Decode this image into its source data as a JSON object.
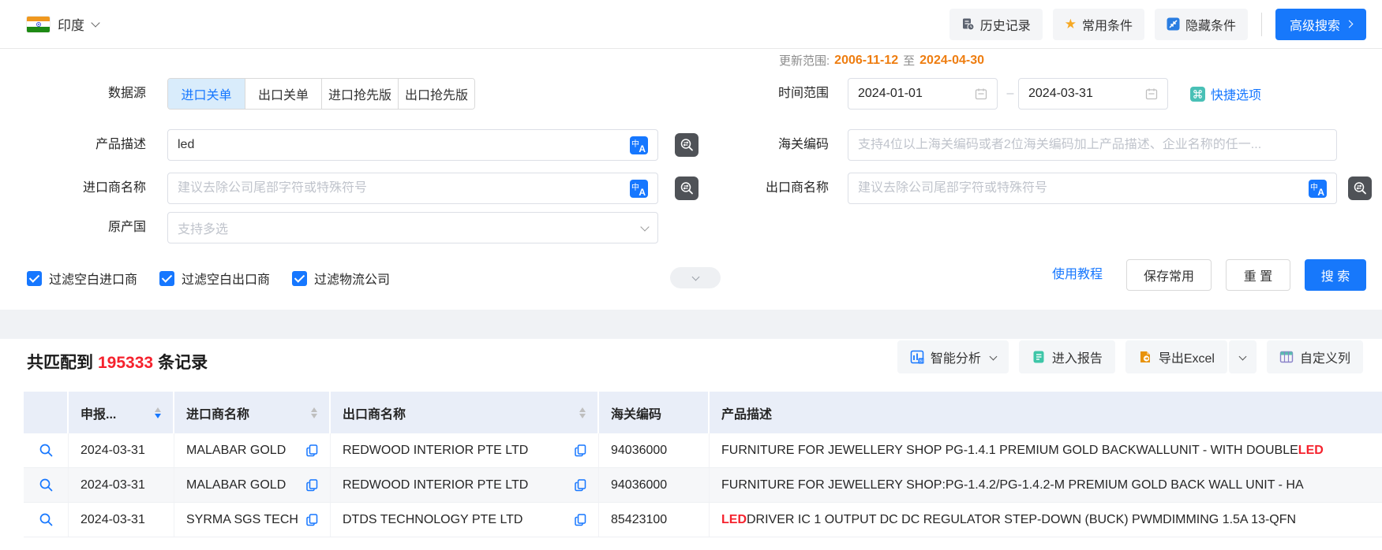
{
  "toolbar": {
    "country": "印度",
    "history_label": "历史记录",
    "favorites_label": "常用条件",
    "hide_label": "隐藏条件",
    "advanced_label": "高级搜索"
  },
  "filters": {
    "data_source_label": "数据源",
    "tabs": [
      {
        "label": "进口关单",
        "active": true
      },
      {
        "label": "出口关单",
        "active": false
      },
      {
        "label": "进口抢先版",
        "active": false
      },
      {
        "label": "出口抢先版",
        "active": false
      }
    ],
    "update_range": {
      "label": "更新范围:",
      "from": "2006-11-12",
      "to_word": "至",
      "to": "2024-04-30"
    },
    "time_range": {
      "label": "时间范围",
      "start": "2024-01-01",
      "end": "2024-03-31"
    },
    "quick_option_label": "快捷选项",
    "product_desc": {
      "label": "产品描述",
      "value": "led"
    },
    "hs_code": {
      "label": "海关编码",
      "placeholder": "支持4位以上海关编码或者2位海关编码加上产品描述、企业名称的任一..."
    },
    "importer": {
      "label": "进口商名称",
      "placeholder": "建议去除公司尾部字符或特殊符号"
    },
    "exporter": {
      "label": "出口商名称",
      "placeholder": "建议去除公司尾部字符或特殊符号"
    },
    "origin": {
      "label": "原产国",
      "placeholder": "支持多选"
    },
    "checkboxes": [
      {
        "label": "过滤空白进口商",
        "checked": true
      },
      {
        "label": "过滤空白出口商",
        "checked": true
      },
      {
        "label": "过滤物流公司",
        "checked": true
      }
    ],
    "actions": {
      "tutorial": "使用教程",
      "save": "保存常用",
      "reset": "重 置",
      "search": "搜 索"
    }
  },
  "results": {
    "summary": {
      "prefix": "共匹配到",
      "count": "195333",
      "suffix": "条记录"
    },
    "buttons": {
      "analyze": "智能分析",
      "report": "进入报告",
      "export": "导出Excel",
      "columns": "自定义列"
    },
    "table": {
      "headers": {
        "date": "申报...",
        "importer": "进口商名称",
        "exporter": "出口商名称",
        "hs": "海关编码",
        "desc": "产品描述"
      },
      "sort": {
        "date": "desc-active",
        "importer": "none",
        "exporter": "none"
      },
      "rows": [
        {
          "date": "2024-03-31",
          "importer": "MALABAR GOLD",
          "exporter": "REDWOOD INTERIOR PTE LTD",
          "hs": "94036000",
          "desc_parts": [
            {
              "text": "FURNITURE FOR JEWELLERY SHOP PG-1.4.1 PREMIUM GOLD BACKWALLUNIT - WITH DOUBLE ",
              "highlight": false
            },
            {
              "text": "LED",
              "highlight": true
            }
          ]
        },
        {
          "date": "2024-03-31",
          "importer": "MALABAR GOLD",
          "exporter": "REDWOOD INTERIOR PTE LTD",
          "hs": "94036000",
          "desc_parts": [
            {
              "text": "FURNITURE FOR JEWELLERY SHOP:PG-1.4.2/PG-1.4.2-M PREMIUM GOLD BACK WALL UNIT - HA",
              "highlight": false
            }
          ]
        },
        {
          "date": "2024-03-31",
          "importer": "SYRMA SGS TECH",
          "exporter": "DTDS TECHNOLOGY PTE LTD",
          "hs": "85423100",
          "desc_parts": [
            {
              "text": "LED",
              "highlight": true
            },
            {
              "text": " DRIVER IC 1 OUTPUT DC DC REGULATOR STEP-DOWN (BUCK) PWMDIMMING 1.5A 13-QFN",
              "highlight": false
            }
          ]
        }
      ]
    }
  },
  "icons": {
    "india-flag": "tricolor flag with chakra",
    "history": "document with clock",
    "favorites": "gold star ★",
    "hide-conditions": "blue collapse arrows",
    "advanced-arrow": "chevron-right ›",
    "calendar": "calendar glyph",
    "quick-option": "teal command key ⌘",
    "translate": "blue 中/A badge",
    "exact-match": "dark magnifier with swap arrows",
    "dropdown": "chevron-down ∨",
    "row-search": "blue magnifier",
    "copy": "blue duplicate sheets",
    "analyze": "blue BI chart",
    "report": "teal notebook",
    "export-excel": "orange sheet with arrow",
    "custom-columns": "teal column grid"
  },
  "colors": {
    "primary": "#1778fb",
    "tab_active_bg": "#d9ecfb",
    "count_red": "#f5222d",
    "update_orange": "#ee7d10",
    "header_bg": "#e9eef8",
    "band_gray": "#f0f2f5",
    "star_gold": "#f6a823",
    "icon_teal": "#49c0b6",
    "icon_orange": "#e8930c",
    "icon_dark": "#4f5257"
  }
}
